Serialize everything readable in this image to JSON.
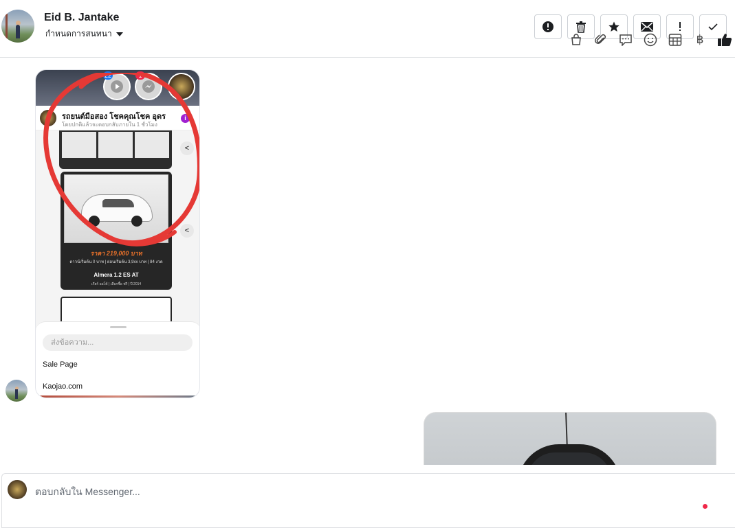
{
  "header": {
    "contact_name": "Eid B. Jantake",
    "assign_label": "กำหนดการสนทนา",
    "toolbar": [
      {
        "name": "spam-button",
        "icon": "alert-circle-icon",
        "glyph": "!"
      },
      {
        "name": "delete-button",
        "icon": "trash-icon",
        "glyph": "🗑"
      },
      {
        "name": "star-button",
        "icon": "star-icon",
        "glyph": "★"
      },
      {
        "name": "mark-unread-button",
        "icon": "envelope-icon",
        "glyph": "✉"
      },
      {
        "name": "follow-up-button",
        "icon": "exclamation-icon",
        "glyph": "!"
      },
      {
        "name": "mark-done-button",
        "icon": "check-icon",
        "glyph": "✓"
      }
    ]
  },
  "shared_screenshot": {
    "badge_video": "22",
    "badge_messenger": "1",
    "page_title": "รถยนต์มือสอง โชคคุณโชค อุดร",
    "page_subtitle": "โดยปกติแล้วจะตอบกลับภายใน 1 ชั่วโมง",
    "price_text": "ราคา 219,000 บาท",
    "finance_text": "ดาวน์เริ่มต้น 0 บาท | ผ่อนเริ่มต้น 3,9xx บาท | 84 งวด",
    "model_text": "Almera 1.2 ES AT",
    "detail_text": "เกียร์ ออโต้ | เลือกซื้อ ฟรี | ปี 2014",
    "message_placeholder": "ส่งข้อความ...",
    "options": [
      "Sale Page",
      "Kaojao.com"
    ]
  },
  "composer": {
    "placeholder": "ตอบกลับใน Messenger...",
    "icons": [
      "shop-bag-icon",
      "attachment-icon",
      "saved-reply-icon",
      "emoji-icon",
      "table-icon",
      "baht-icon",
      "like-icon"
    ],
    "icon_glyphs": [
      "⛟",
      "🖇",
      "💬",
      "☺",
      "▦",
      "฿",
      "👍"
    ]
  },
  "colors": {
    "accent_blue": "#1877f2",
    "annotation_red": "#e53935",
    "notification_red": "#f02849"
  }
}
